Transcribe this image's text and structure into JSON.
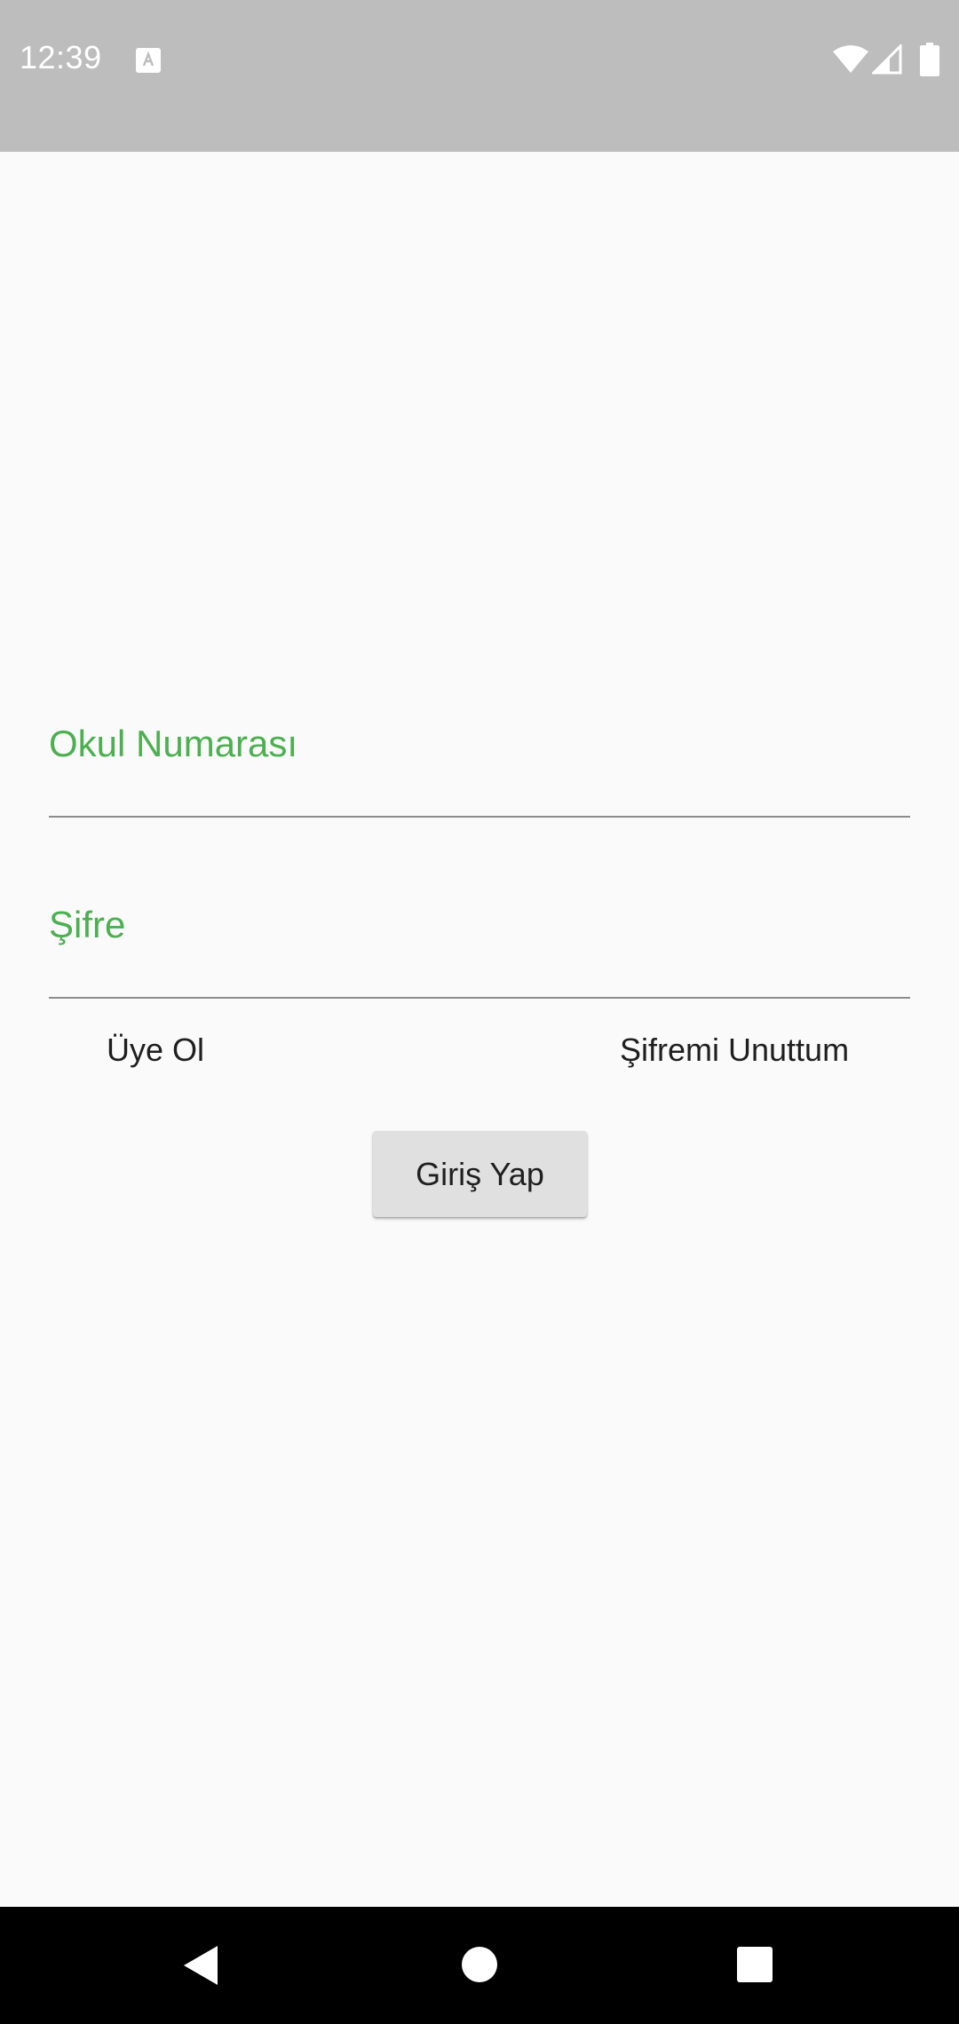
{
  "status_bar": {
    "time": "12:39",
    "icons": [
      "text-a-icon",
      "wifi-icon",
      "signal-icon",
      "battery-icon"
    ],
    "background": "#bdbdbd"
  },
  "form": {
    "school_number": {
      "label": "Okul Numarası",
      "value": ""
    },
    "password": {
      "label": "Şifre",
      "value": ""
    },
    "accent_color": "#4caf50"
  },
  "links": {
    "register": "Üye Ol",
    "forgot_password": "Şifremi Unuttum"
  },
  "login_button": {
    "label": "Giriş Yap"
  },
  "nav_bar": {
    "icons": [
      "back-icon",
      "home-icon",
      "recents-icon"
    ]
  }
}
